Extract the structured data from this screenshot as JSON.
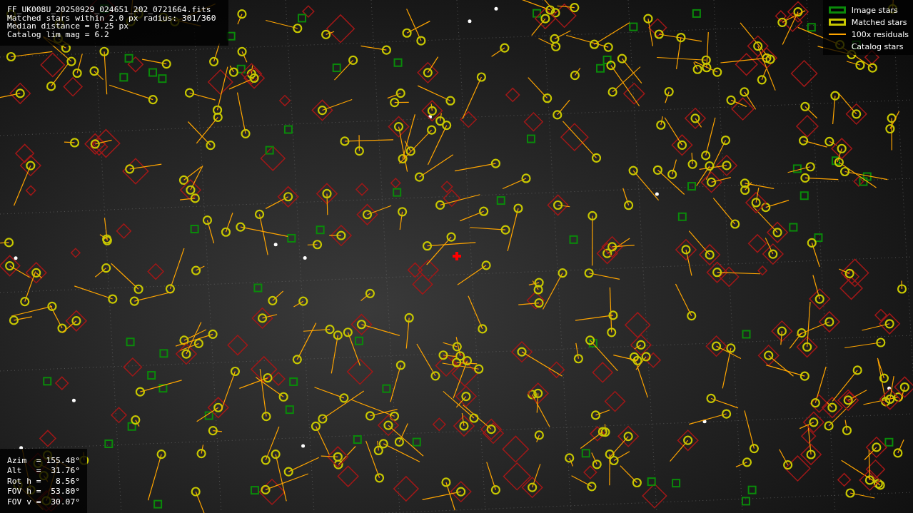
{
  "info": {
    "lines": [
      "FF_UK008U_20250929_024651_202_0721664.fits",
      "Matched stars within 2.0 px radius: 301/360",
      "Median distance = 0.25 px",
      "Catalog lim mag = 6.2"
    ]
  },
  "legend": [
    {
      "kind": "image",
      "label": "Image stars"
    },
    {
      "kind": "matched",
      "label": "Matched stars"
    },
    {
      "kind": "residual",
      "label": "100x residuals"
    },
    {
      "kind": "catalog",
      "label": "Catalog stars"
    }
  ],
  "pointing": {
    "lines": [
      "Azim  = 155.48°",
      "Alt   =  31.76°",
      "Rot h =   8.56°",
      "FOV h =  53.80°",
      "FOV v =  30.07°"
    ]
  }
}
